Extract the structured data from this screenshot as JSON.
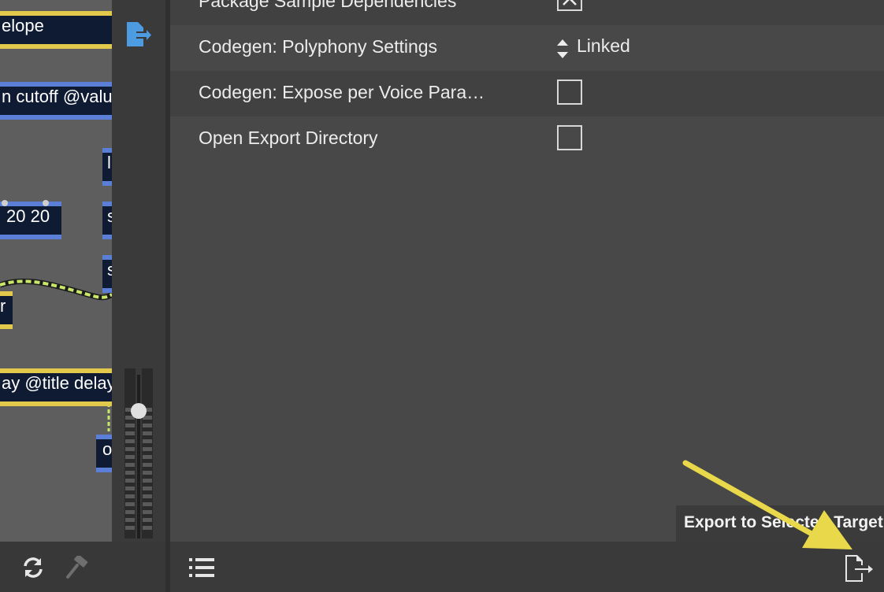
{
  "patcher": {
    "objects": [
      {
        "text": "elope"
      },
      {
        "text": "n cutoff @valu"
      },
      {
        "text": "l"
      },
      {
        "text": "20 20"
      },
      {
        "text": "s"
      },
      {
        "text": "s"
      },
      {
        "text": "r"
      },
      {
        "text": "ay @title delay"
      },
      {
        "text": "o"
      }
    ]
  },
  "settings": {
    "rows": [
      {
        "label": "Package Sample Dependencies",
        "control": "checkbox",
        "checked": true
      },
      {
        "label": "Codegen: Polyphony Settings",
        "control": "stepper",
        "value": "Linked"
      },
      {
        "label": "Codegen: Expose per Voice Para…",
        "control": "checkbox",
        "checked": false
      },
      {
        "label": "Open Export Directory",
        "control": "checkbox",
        "checked": false
      }
    ]
  },
  "tooltip": {
    "text": "Export to Selected Target"
  },
  "colors": {
    "accent_yellow": "#e2c84b",
    "object_blue": "#5b7fd6",
    "export_icon_blue": "#4d9be0",
    "annotation_arrow": "#e8d84a"
  },
  "icons": {
    "top_export": "export-icon",
    "refresh": "refresh-icon",
    "build": "hammer-icon",
    "list": "list-icon",
    "export_bottom": "export-to-target-icon"
  }
}
